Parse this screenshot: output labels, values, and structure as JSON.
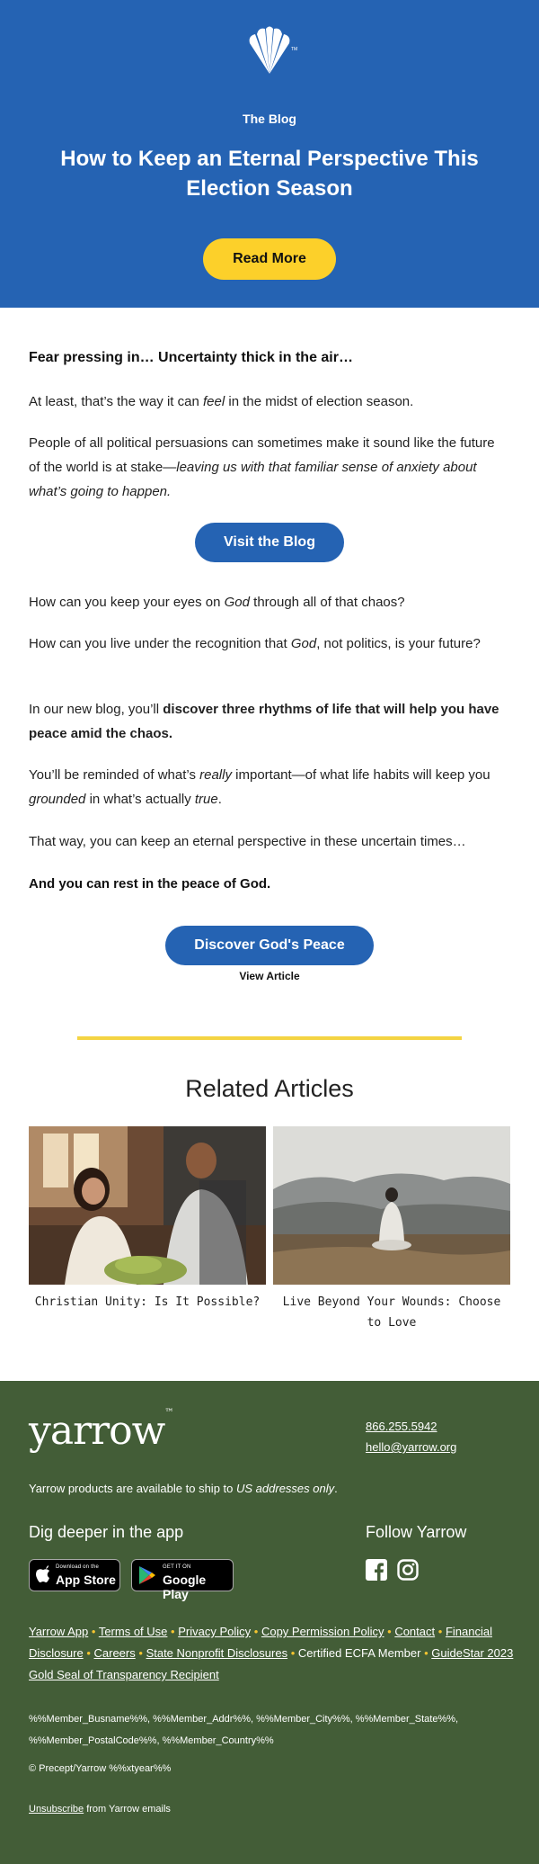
{
  "header": {
    "logo_icon": "yarrow-flower-icon",
    "eyebrow": "The Blog",
    "title": "How to Keep an Eternal Perspective This Election Season",
    "cta": "Read More",
    "bg_color": "#2563b3",
    "cta_color": "#fcd02a"
  },
  "body": {
    "lead": "Fear pressing in… Uncertainty thick in the air…",
    "p1_a": "At least, that’s the way it can ",
    "p1_em": "feel",
    "p1_b": " in the midst of election season.",
    "p2_a": "People of all political persuasions can sometimes make it sound like the future of the world is at stake—",
    "p2_em": "leaving us with that familiar sense of anxiety about what’s going to happen.",
    "cta1": "Visit the Blog",
    "p3_a": "How can you keep your eyes on ",
    "p3_em": "God",
    "p3_b": " through all of that chaos?",
    "p4_a": "How can you live under the recognition that ",
    "p4_em": "God",
    "p4_b": ", not politics, is your future?",
    "p5_a": "In our new blog, you’ll ",
    "p5_strong": "discover three rhythms of life that will help you have peace amid the chaos.",
    "p6_a": "You’ll be reminded of what’s ",
    "p6_em1": "really",
    "p6_b": " important—of what life habits will keep you ",
    "p6_em2": "grounded",
    "p6_c": " in what’s actually ",
    "p6_em3": "true",
    "p6_d": ".",
    "p7": "That way, you can keep an eternal perspective in these uncertain times…",
    "p8": "And you can rest in the peace of God.",
    "cta2": "Discover God's Peace",
    "view_article": "View Article"
  },
  "related": {
    "title": "Related Articles",
    "articles": [
      {
        "caption": "Christian Unity: Is It Possible?"
      },
      {
        "caption": "Live Beyond Your Wounds: Choose to Love"
      }
    ]
  },
  "footer": {
    "logo": "yarrow",
    "logo_tm": "™",
    "phone": "866.255.5942",
    "email": "hello@yarrow.org",
    "ship_a": "Yarrow products are available to ship to ",
    "ship_em": "US addresses only",
    "ship_b": ".",
    "app_heading": "Dig deeper in the app",
    "follow_heading": "Follow Yarrow",
    "appstore_small": "Download on the",
    "appstore_big": "App Store",
    "googleplay_small": "GET IT ON",
    "googleplay_big": "Google Play",
    "social_icons": [
      "facebook-icon",
      "instagram-icon"
    ],
    "links": {
      "app": "Yarrow App",
      "terms": "Terms of Use",
      "privacy": "Privacy Policy",
      "copy_permission": "Copy Permission Policy",
      "contact": "Contact",
      "financial": "Financial Disclosure",
      "careers": "Careers",
      "state": "State Nonprofit Disclosures",
      "ecfa": "Certified ECFA Member",
      "guidestar": "GuideStar 2023 Gold Seal of Transparency Recipient"
    },
    "merge_fields": "%%Member_Busname%%, %%Member_Addr%%, %%Member_City%%, %%Member_State%%, %%Member_PostalCode%%, %%Member_Country%%",
    "copyright": "© Precept/Yarrow %%xtyear%%",
    "unsubscribe": "Unsubscribe",
    "unsubscribe_rest": " from Yarrow emails",
    "bg_color": "#435d37",
    "accent_dot_color": "#f4c430"
  }
}
